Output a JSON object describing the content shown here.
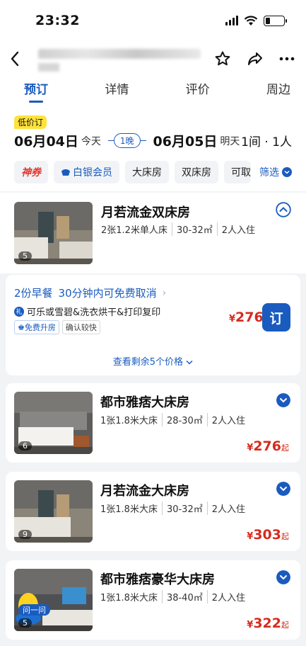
{
  "status": {
    "time": "23:32"
  },
  "nav": {
    "back_icon": "back-arrow-icon",
    "star_icon": "star-icon",
    "share_icon": "share-icon",
    "more_icon": "more-icon"
  },
  "tabs": [
    {
      "label": "预订"
    },
    {
      "label": "详情"
    },
    {
      "label": "评价"
    },
    {
      "label": "周边"
    }
  ],
  "dates": {
    "low_price_tag": "低价订",
    "checkin": "06月04日",
    "checkin_day": "今天",
    "nights": "1晚",
    "checkout": "06月05日",
    "checkout_day": "明天",
    "rooms_guests": "1间 · 1人"
  },
  "filters": {
    "chips": [
      "神券",
      "白银会员",
      "大床房",
      "双床房",
      "可取"
    ],
    "filter_label": "筛选"
  },
  "expanded_room": {
    "name": "月若流金双床房",
    "spec": [
      "2张1.2米单人床",
      "30-32㎡",
      "2人入住"
    ],
    "photo_count": "5"
  },
  "offer": {
    "breakfast": "2份早餐",
    "cancel": "30分钟内可免费取消",
    "perk": "可乐或雪碧&洗衣烘干&打印复印",
    "gift_icon": "礼",
    "tags": [
      "免费升房",
      "确认较快"
    ],
    "currency": "¥",
    "price": "276",
    "book_label": "订",
    "more_prices": "查看剩余5个价格"
  },
  "rooms": [
    {
      "name": "都市雅痞大床房",
      "spec": [
        "1张1.8米大床",
        "28-30㎡",
        "2人入住"
      ],
      "photo_count": "6",
      "currency": "¥",
      "price": "276",
      "suffix": "起"
    },
    {
      "name": "月若流金大床房",
      "spec": [
        "1张1.8米大床",
        "30-32㎡",
        "2人入住"
      ],
      "photo_count": "9",
      "currency": "¥",
      "price": "303",
      "suffix": "起"
    },
    {
      "name": "都市雅痞豪华大床房",
      "spec": [
        "1张1.8米大床",
        "38-40㎡",
        "2人入住"
      ],
      "photo_count": "5",
      "currency": "¥",
      "price": "322",
      "suffix": "起",
      "ask_label": "问一问"
    }
  ],
  "colors": {
    "brand_blue": "#1a5bbf",
    "price_red": "#d62b1e",
    "low_price_yellow": "#ffe23b"
  }
}
